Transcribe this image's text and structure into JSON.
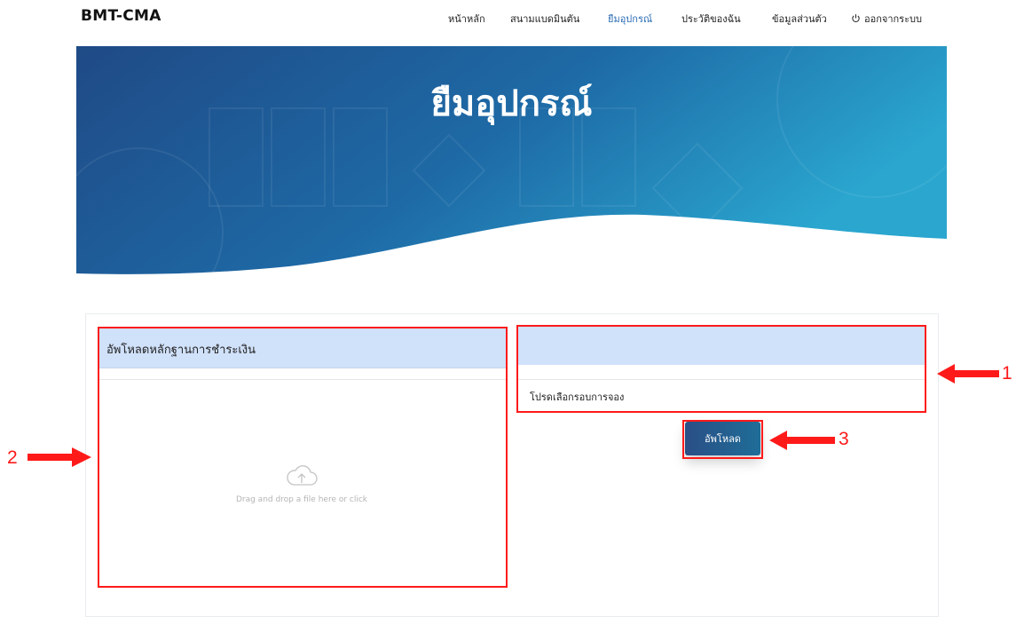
{
  "header": {
    "brand": "BMT-CMA",
    "nav": [
      {
        "label": "หน้าหลัก"
      },
      {
        "label": "สนามแบดมินตัน"
      },
      {
        "label": "ยืมอุปกรณ์"
      },
      {
        "label": "ประวัติของฉัน"
      },
      {
        "label": "ข้อมูลส่วนตัว"
      },
      {
        "label": "ออกจากระบบ"
      }
    ],
    "active_nav": "ยืมอุปกรณ์",
    "logout_icon": "power-icon"
  },
  "hero": {
    "title": "ยืมอุปกรณ์"
  },
  "upload_panel": {
    "heading": "อัพโหลดหลักฐานการชำระเงิน",
    "dropzone_text": "Drag and drop a file here or click",
    "dropzone_icon": "cloud-upload-icon"
  },
  "booking_panel": {
    "heading": "",
    "select_hint": "โปรดเลือกรอบการจอง",
    "upload_button": "อัพโหลด"
  },
  "annotations": {
    "labels": [
      "1",
      "2",
      "3"
    ],
    "color": "#ff1a1a"
  },
  "colors": {
    "accent": "#2a6bb5",
    "panel_header": "#d0e1fa",
    "hero_dark": "#1e4f8a",
    "hero_light": "#2aa6cf"
  }
}
